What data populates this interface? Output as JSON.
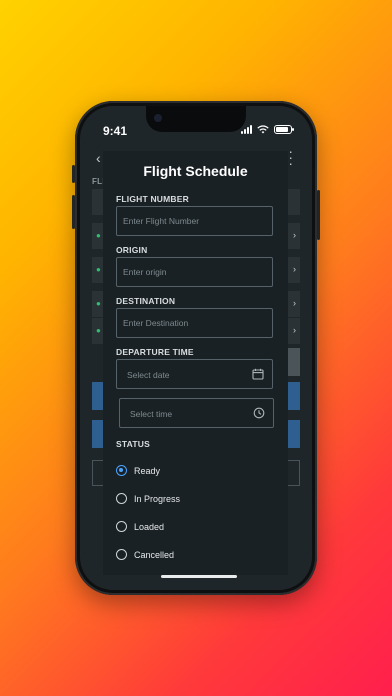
{
  "status_bar": {
    "time": "9:41"
  },
  "background_app": {
    "section_label": "FLIGHT",
    "row_chevron": "›"
  },
  "modal": {
    "title": "Flight Schedule",
    "flight_number": {
      "label": "FLIGHT NUMBER",
      "placeholder": "Enter Flight Number"
    },
    "origin": {
      "label": "ORIGIN",
      "placeholder": "Enter origin"
    },
    "destination": {
      "label": "DESTINATION",
      "placeholder": "Enter Destination"
    },
    "departure_time": {
      "label": "DEPARTURE TIME",
      "date_placeholder": "Select date",
      "time_placeholder": "Select time"
    },
    "status": {
      "label": "STATUS",
      "options": [
        "Ready",
        "In Progress",
        "Loaded",
        "Cancelled"
      ],
      "selected": "Ready"
    }
  },
  "colors": {
    "accent": "#4aa3ff",
    "modal_bg": "#1a2124",
    "button_blue": "#2f5f91"
  }
}
